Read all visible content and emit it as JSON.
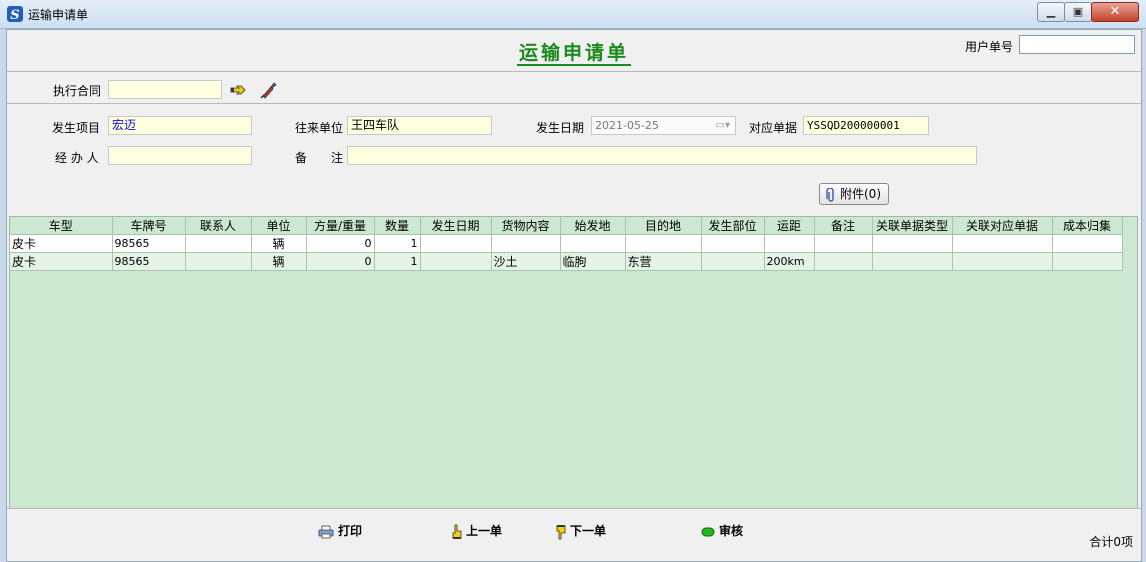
{
  "window": {
    "title": "运输申请单"
  },
  "header": {
    "form_title": "运输申请单",
    "user_no_label": "用户单号",
    "user_no_value": ""
  },
  "contract": {
    "label": "执行合同",
    "value": ""
  },
  "fields": {
    "project_label": "发生项目",
    "project_value": "宏迈",
    "partner_label": "往来单位",
    "partner_value": "王四车队",
    "date_label": "发生日期",
    "date_value": "2021-05-25",
    "ref_label": "对应单据",
    "ref_value": "YSSQD200000001",
    "handler_label": "经 办 人",
    "handler_value": "",
    "remark_label": "备　　注",
    "remark_value": ""
  },
  "attachment": {
    "label": "附件(0)"
  },
  "table": {
    "columns": [
      "车型",
      "车牌号",
      "联系人",
      "单位",
      "方量/重量",
      "数量",
      "发生日期",
      "货物内容",
      "始发地",
      "目的地",
      "发生部位",
      "运距",
      "备注",
      "关联单据类型",
      "关联对应单据",
      "成本归集"
    ],
    "rows": [
      [
        "皮卡",
        "98565",
        "",
        "辆",
        "0",
        "1",
        "",
        "",
        "",
        "",
        "",
        "",
        "",
        "",
        "",
        ""
      ],
      [
        "皮卡",
        "98565",
        "",
        "辆",
        "0",
        "1",
        "",
        "沙土",
        "临朐",
        "东营",
        "",
        "200km",
        "",
        "",
        "",
        ""
      ]
    ]
  },
  "footer": {
    "print_label": "打印",
    "prev_label": "上一单",
    "next_label": "下一单",
    "audit_label": "审核",
    "total_text": "合计0项"
  }
}
